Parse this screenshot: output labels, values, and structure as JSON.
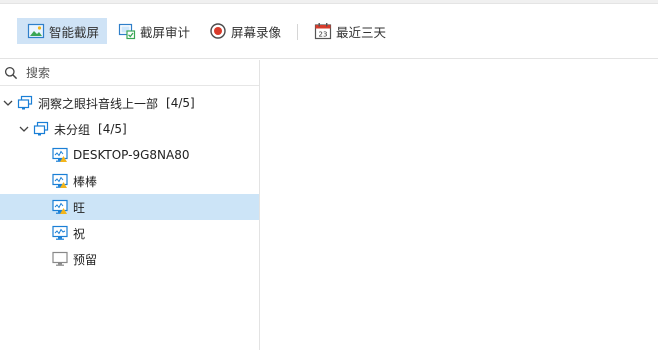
{
  "toolbar": {
    "items": [
      {
        "label": "智能截屏",
        "icon": "smart-screenshot-icon",
        "active": true
      },
      {
        "label": "截屏审计",
        "icon": "screenshot-audit-icon",
        "active": false
      },
      {
        "label": "屏幕录像",
        "icon": "record-icon",
        "active": false
      },
      {
        "label": "最近三天",
        "icon": "calendar-icon",
        "active": false
      }
    ]
  },
  "search": {
    "placeholder": "搜索"
  },
  "tree": {
    "root": {
      "label": "洞察之眼抖音线上一部",
      "count": "[4/5]"
    },
    "group": {
      "label": "未分组",
      "count": "[4/5]"
    },
    "devices": [
      {
        "label": "DESKTOP-9G8NA80",
        "status": "online-warning"
      },
      {
        "label": "棒棒",
        "status": "online-warning"
      },
      {
        "label": "旺",
        "status": "online-warning",
        "selected": true
      },
      {
        "label": "祝",
        "status": "online"
      },
      {
        "label": "预留",
        "status": "offline"
      }
    ]
  },
  "colors": {
    "accent": "#1a7fd6",
    "selected_bg": "#cce4f7",
    "record_red": "#d83b2b"
  }
}
